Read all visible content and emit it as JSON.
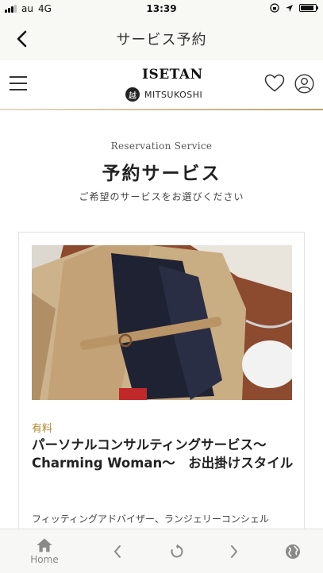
{
  "status_bar": {
    "carrier": "au",
    "network": "4G",
    "time": "13:39",
    "battery_level": 0.9
  },
  "nav": {
    "title": "サービス予約",
    "back_icon": "chevron-left-icon"
  },
  "header": {
    "menu_icon": "hamburger-menu-icon",
    "logo_top": "ISETAN",
    "logo_bottom": "MITSUKOSHI",
    "logo_mark": "越",
    "favorites_icon": "heart-icon",
    "account_icon": "user-icon",
    "accent_color": "#b5a46a"
  },
  "section": {
    "title_en": "Reservation Service",
    "title": "予約サービス",
    "subtitle": "ご希望のサービスをお選びください"
  },
  "card": {
    "image_alt": "",
    "badge": "有料",
    "title": "パーソナルコンサルティングサービス〜Charming Woman〜　お出掛けスタイル",
    "description": "フィッティングアドバイザー、ランジェリーコンシェル",
    "badge_color": "#b08a2e"
  },
  "toolbar": {
    "home_label": "Home",
    "home_icon": "home-icon",
    "back_icon": "chevron-left-icon",
    "reload_icon": "reload-icon",
    "forward_icon": "chevron-right-icon",
    "globe_icon": "globe-icon"
  }
}
